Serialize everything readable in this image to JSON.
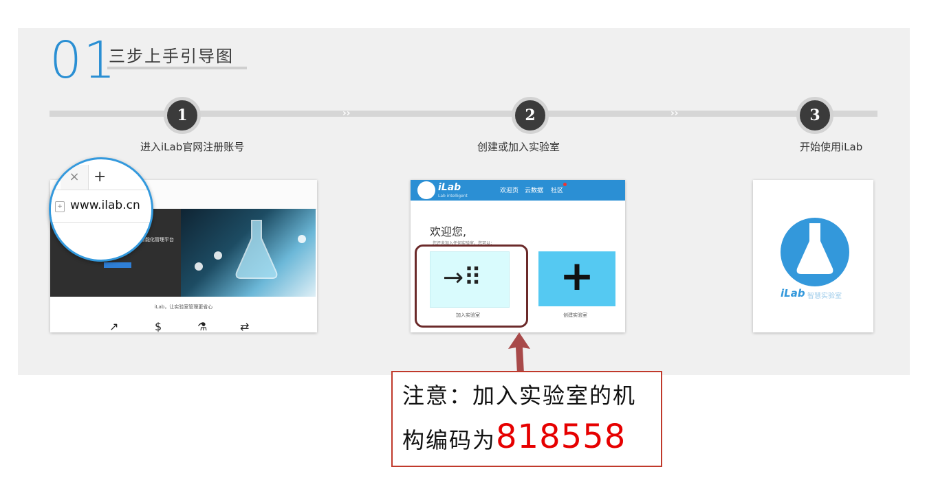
{
  "section": {
    "number": "01",
    "title": "三步上手引导图"
  },
  "steps": [
    {
      "n": "1",
      "label": "进入iLab官网注册账号"
    },
    {
      "n": "2",
      "label": "创建或加入实验室"
    },
    {
      "n": "3",
      "label": "开始使用iLab"
    }
  ],
  "shot1": {
    "url": "www.ilab.cn",
    "tab_close": "×",
    "tab_new": "+",
    "hero_text": "室智能化管理平台",
    "caption": "iLab，让实验室管理更省心"
  },
  "shot2": {
    "logo": "iLab",
    "logo_sub": "Lab intelligent",
    "nav": [
      "欢迎页",
      "云数据",
      "社区"
    ],
    "welcome": "欢迎您,",
    "sub": "您还未加入任何实验室，您可以：",
    "join_symbol": "→⠿",
    "create_symbol": "+",
    "join_label": "加入实验室",
    "create_label": "创建实验室"
  },
  "shot3": {
    "logo_text": "iLab",
    "logo_sub": "智慧实验室"
  },
  "note": {
    "line1": "注意：加入实验室的机",
    "line2_prefix": "构编码为",
    "code": "818558"
  },
  "colors": {
    "accent": "#2a8fd3",
    "code": "#e60000",
    "note_border": "#c0392b"
  }
}
